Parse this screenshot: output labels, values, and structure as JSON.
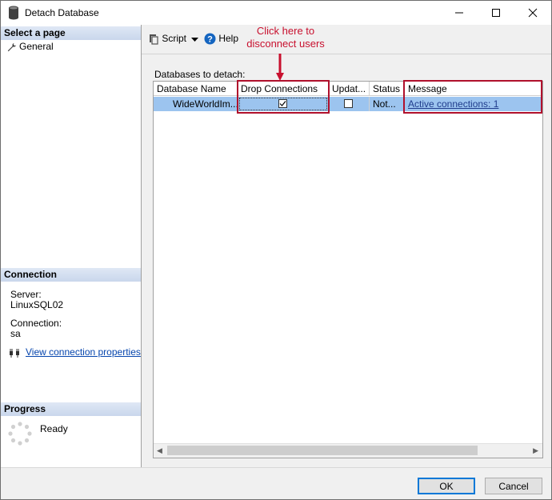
{
  "window": {
    "title": "Detach Database"
  },
  "sidebar": {
    "select_page_heading": "Select a page",
    "pages": [
      {
        "label": "General"
      }
    ],
    "connection_heading": "Connection",
    "server_label": "Server:",
    "server_value": "LinuxSQL02",
    "connection_label": "Connection:",
    "connection_value": "sa",
    "view_props_link": "View connection properties",
    "progress_heading": "Progress",
    "progress_status": "Ready"
  },
  "toolbar": {
    "script_label": "Script",
    "help_label": "Help"
  },
  "annotation": {
    "line1": "Click here to",
    "line2": "disconnect users",
    "color": "#c8102e"
  },
  "grid": {
    "label": "Databases to detach:",
    "columns": [
      "Database Name",
      "Drop Connections",
      "Updat...",
      "Status",
      "Message"
    ],
    "rows": [
      {
        "database_name": "WideWorldIm...",
        "drop_connections": true,
        "update": false,
        "status": "Not...",
        "message": "Active connections: 1"
      }
    ]
  },
  "buttons": {
    "ok_label": "OK",
    "cancel_label": "Cancel"
  },
  "colors": {
    "selection": "#9cc4ef",
    "highlight": "#b0102c",
    "link": "#0645ad"
  }
}
